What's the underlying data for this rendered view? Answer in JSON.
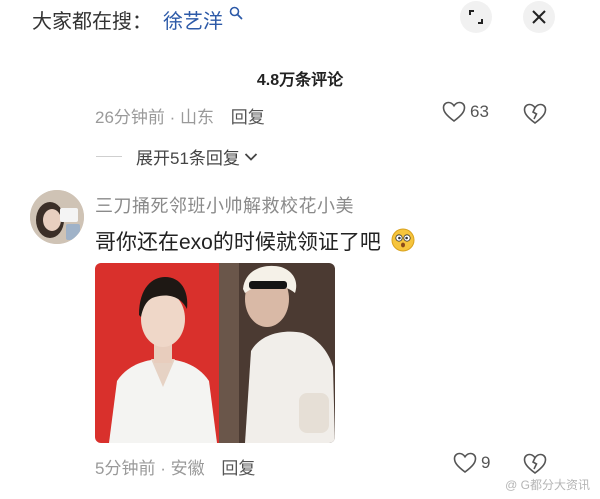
{
  "search": {
    "hint": "大家都在搜：",
    "keyword": "徐艺洋"
  },
  "comments_header": {
    "count_label": "4.8万条评论"
  },
  "prev_comment": {
    "time": "26分钟前",
    "location": "山东",
    "reply_label": "回复",
    "like_count": "63"
  },
  "expand": {
    "label": "展开51条回复"
  },
  "comment": {
    "username": "三刀捅死邻班小帅解救校花小美",
    "text": "哥你还在exo的时候就领证了吧",
    "time": "5分钟前",
    "location": "安徽",
    "reply_label": "回复",
    "like_count": "9"
  },
  "watermark": "@ G都分大资讯",
  "colors": {
    "keyword": "#2d5aa8",
    "meta_gray": "#9a9a9a",
    "photo_red": "#d9302c"
  },
  "icons": [
    "search-icon",
    "expand-icon",
    "close-icon",
    "heart-icon",
    "broken-heart-icon",
    "chevron-down-icon",
    "emoji-icon"
  ]
}
